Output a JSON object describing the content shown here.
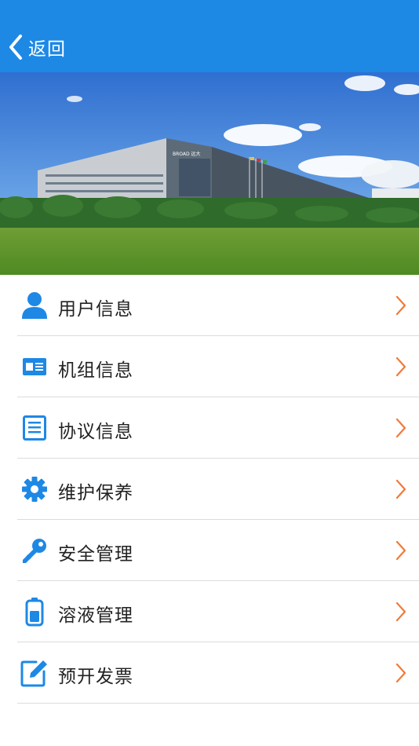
{
  "header": {
    "back_label": "返回",
    "background_color": "#1E88E5"
  },
  "banner": {
    "building_sign": "BROAD 远大"
  },
  "menu": {
    "icon_color": "#1E88E5",
    "chevron_color": "#F07A38",
    "items": [
      {
        "label": "用户信息",
        "icon": "user-icon"
      },
      {
        "label": "机组信息",
        "icon": "id-card-icon"
      },
      {
        "label": "协议信息",
        "icon": "document-icon"
      },
      {
        "label": "维护保养",
        "icon": "gear-icon"
      },
      {
        "label": "安全管理",
        "icon": "key-icon"
      },
      {
        "label": "溶液管理",
        "icon": "battery-icon"
      },
      {
        "label": "预开发票",
        "icon": "edit-icon"
      }
    ]
  }
}
